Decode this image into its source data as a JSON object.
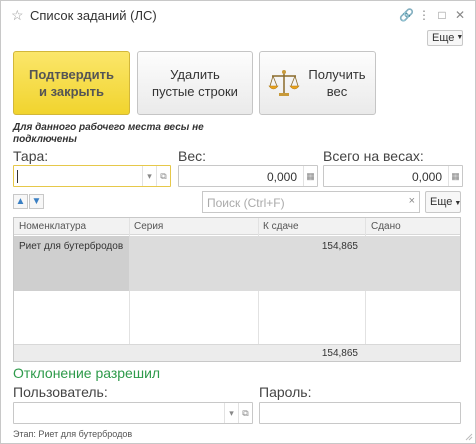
{
  "window": {
    "title": "Список заданий (ЛС)",
    "more_label": "Еще"
  },
  "buttons": {
    "confirm_line1": "Подтвердить",
    "confirm_line2": "и закрыть",
    "delete_line1": "Удалить",
    "delete_line2": "пустые строки",
    "get_weight_line1": "Получить",
    "get_weight_line2": "вес"
  },
  "warning": "Для данного рабочего места весы не подключены",
  "fields": {
    "tara_label": "Тара:",
    "tara_value": "",
    "ves_label": "Вес:",
    "ves_value": "0,000",
    "total_label": "Всего на весах:",
    "total_value": "0,000"
  },
  "toolbar": {
    "search_placeholder": "Поиск (Ctrl+F)",
    "more_label": "Еще"
  },
  "table": {
    "columns": [
      "Номенклатура",
      "Серия",
      "К сдаче",
      "Сдано"
    ],
    "rows": [
      {
        "item": "Риет для бутербродов",
        "series": "",
        "to_deliver": "154,865",
        "delivered": ""
      }
    ],
    "footer_total": "154,865"
  },
  "deviation": {
    "title": "Отклонение разрешил",
    "user_label": "Пользователь:",
    "user_value": "",
    "password_label": "Пароль:",
    "password_value": ""
  },
  "stage": "Этап:  Риет для бутербродов",
  "colors": {
    "primary_button": "#f1d42e",
    "deviation_title": "#2d9a4a",
    "focus_border": "#e6c84a",
    "arrow": "#3a7fc3"
  }
}
